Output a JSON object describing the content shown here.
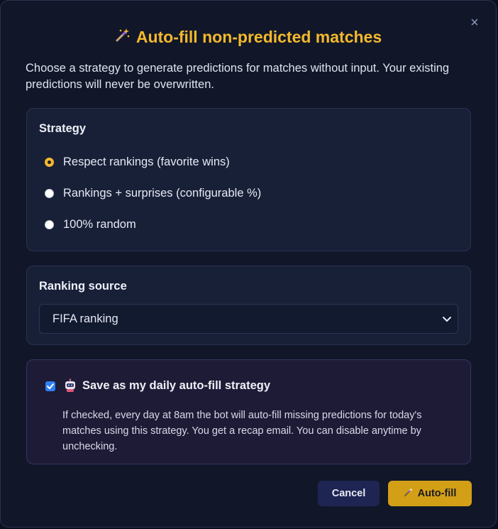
{
  "modal": {
    "title_icon": "wand-icon",
    "title": "Auto-fill non-predicted matches",
    "close_label": "×",
    "intro": "Choose a strategy to generate predictions for matches without input. Your existing predictions will never be overwritten."
  },
  "strategy": {
    "heading": "Strategy",
    "options": [
      {
        "label": "Respect rankings (favorite wins)",
        "checked": true
      },
      {
        "label": "Rankings + surprises (configurable %)",
        "checked": false
      },
      {
        "label": "100% random",
        "checked": false
      }
    ]
  },
  "ranking_source": {
    "heading": "Ranking source",
    "selected": "FIFA ranking"
  },
  "save": {
    "checked": true,
    "icon": "robot-icon",
    "label": "Save as my daily auto-fill strategy",
    "description": "If checked, every day at 8am the bot will auto-fill missing predictions for today's matches using this strategy. You get a recap email. You can disable anytime by unchecking."
  },
  "actions": {
    "cancel_label": "Cancel",
    "autofill_label": "Auto-fill"
  },
  "colors": {
    "accent": "#f4b92c",
    "checkbox": "#2f7ff7",
    "primary_button": "#d29f17",
    "secondary_button": "#1e2552"
  }
}
